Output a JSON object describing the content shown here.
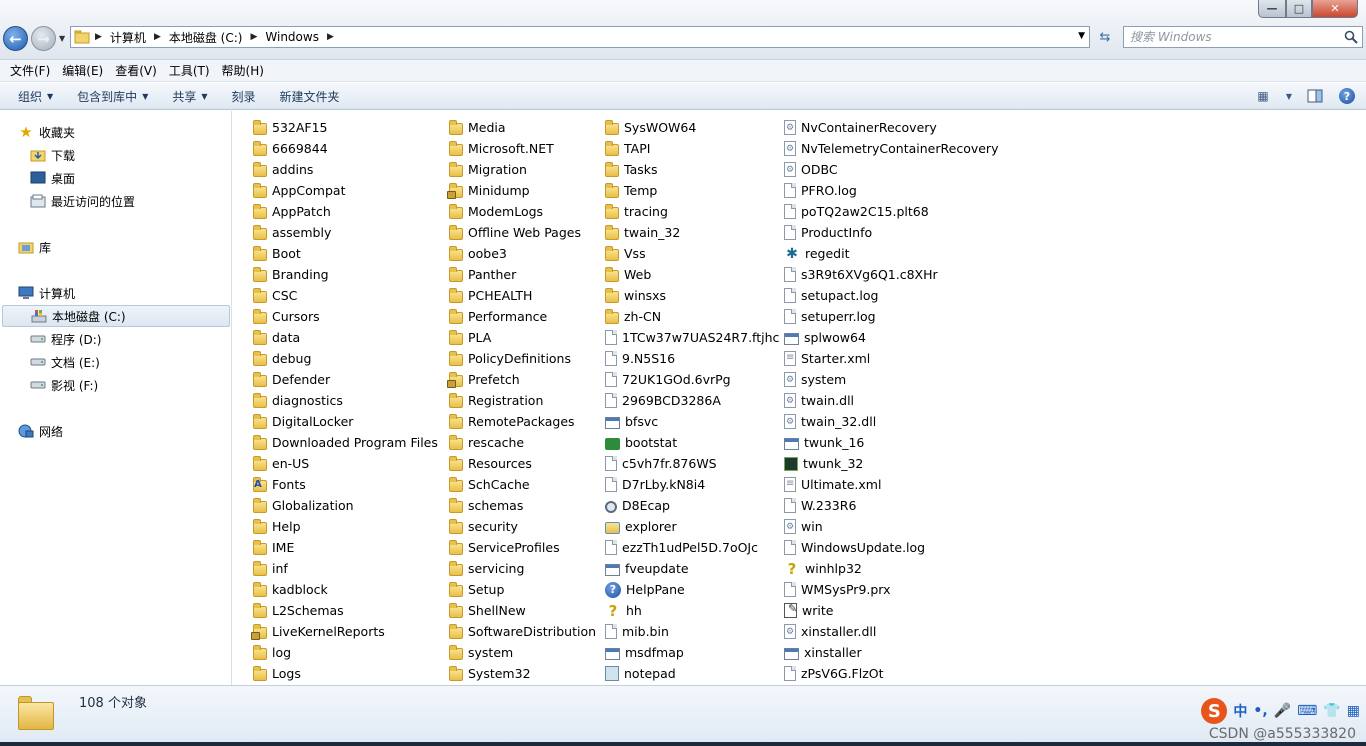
{
  "window": {
    "controls": {
      "minimize": "—",
      "maximize": "□",
      "close": "✕"
    }
  },
  "address": {
    "crumbs": [
      "计算机",
      "本地磁盘 (C:)",
      "Windows"
    ]
  },
  "search": {
    "placeholder": "搜索 Windows"
  },
  "menu": [
    "文件(F)",
    "编辑(E)",
    "查看(V)",
    "工具(T)",
    "帮助(H)"
  ],
  "commands": {
    "organize": "组织",
    "include_in_library": "包含到库中",
    "share": "共享",
    "burn": "刻录",
    "new_folder": "新建文件夹"
  },
  "nav": {
    "favorites": "收藏夹",
    "downloads": "下载",
    "desktop": "桌面",
    "recent": "最近访问的位置",
    "libraries": "库",
    "computer": "计算机",
    "drive_c": "本地磁盘 (C:)",
    "drive_d": "程序 (D:)",
    "drive_e": "文档 (E:)",
    "drive_f": "影视 (F:)",
    "network": "网络"
  },
  "files": {
    "col1": [
      {
        "name": "532AF15",
        "icon": "folder"
      },
      {
        "name": "6669844",
        "icon": "folder"
      },
      {
        "name": "addins",
        "icon": "folder"
      },
      {
        "name": "AppCompat",
        "icon": "folder"
      },
      {
        "name": "AppPatch",
        "icon": "folder"
      },
      {
        "name": "assembly",
        "icon": "folder"
      },
      {
        "name": "Boot",
        "icon": "folder"
      },
      {
        "name": "Branding",
        "icon": "folder"
      },
      {
        "name": "CSC",
        "icon": "folder"
      },
      {
        "name": "Cursors",
        "icon": "folder"
      },
      {
        "name": "data",
        "icon": "folder"
      },
      {
        "name": "debug",
        "icon": "folder"
      },
      {
        "name": "Defender",
        "icon": "folder"
      },
      {
        "name": "diagnostics",
        "icon": "folder"
      },
      {
        "name": "DigitalLocker",
        "icon": "folder"
      },
      {
        "name": "Downloaded Program Files",
        "icon": "folder"
      },
      {
        "name": "en-US",
        "icon": "folder"
      },
      {
        "name": "Fonts",
        "icon": "fontfolder"
      },
      {
        "name": "Globalization",
        "icon": "folder"
      },
      {
        "name": "Help",
        "icon": "folder"
      },
      {
        "name": "IME",
        "icon": "folder"
      },
      {
        "name": "inf",
        "icon": "folder"
      },
      {
        "name": "kadblock",
        "icon": "folder"
      },
      {
        "name": "L2Schemas",
        "icon": "folder"
      },
      {
        "name": "LiveKernelReports",
        "icon": "lockfolder"
      },
      {
        "name": "log",
        "icon": "folder"
      },
      {
        "name": "Logs",
        "icon": "folder"
      }
    ],
    "col2": [
      {
        "name": "Media",
        "icon": "folder"
      },
      {
        "name": "Microsoft.NET",
        "icon": "folder"
      },
      {
        "name": "Migration",
        "icon": "folder"
      },
      {
        "name": "Minidump",
        "icon": "lockfolder"
      },
      {
        "name": "ModemLogs",
        "icon": "folder"
      },
      {
        "name": "Offline Web Pages",
        "icon": "folder"
      },
      {
        "name": "oobe3",
        "icon": "folder"
      },
      {
        "name": "Panther",
        "icon": "folder"
      },
      {
        "name": "PCHEALTH",
        "icon": "folder"
      },
      {
        "name": "Performance",
        "icon": "folder"
      },
      {
        "name": "PLA",
        "icon": "folder"
      },
      {
        "name": "PolicyDefinitions",
        "icon": "folder"
      },
      {
        "name": "Prefetch",
        "icon": "lockfolder"
      },
      {
        "name": "Registration",
        "icon": "folder"
      },
      {
        "name": "RemotePackages",
        "icon": "folder"
      },
      {
        "name": "rescache",
        "icon": "folder"
      },
      {
        "name": "Resources",
        "icon": "folder"
      },
      {
        "name": "SchCache",
        "icon": "folder"
      },
      {
        "name": "schemas",
        "icon": "folder"
      },
      {
        "name": "security",
        "icon": "folder"
      },
      {
        "name": "ServiceProfiles",
        "icon": "folder"
      },
      {
        "name": "servicing",
        "icon": "folder"
      },
      {
        "name": "Setup",
        "icon": "folder"
      },
      {
        "name": "ShellNew",
        "icon": "folder"
      },
      {
        "name": "SoftwareDistribution",
        "icon": "folder"
      },
      {
        "name": "system",
        "icon": "folder"
      },
      {
        "name": "System32",
        "icon": "folder"
      }
    ],
    "col3": [
      {
        "name": "SysWOW64",
        "icon": "folder"
      },
      {
        "name": "TAPI",
        "icon": "folder"
      },
      {
        "name": "Tasks",
        "icon": "folder"
      },
      {
        "name": "Temp",
        "icon": "folder"
      },
      {
        "name": "tracing",
        "icon": "folder"
      },
      {
        "name": "twain_32",
        "icon": "folder"
      },
      {
        "name": "Vss",
        "icon": "folder"
      },
      {
        "name": "Web",
        "icon": "folder"
      },
      {
        "name": "winsxs",
        "icon": "folder"
      },
      {
        "name": "zh-CN",
        "icon": "folder"
      },
      {
        "name": "1TCw37w7UAS24R7.ftjhc",
        "icon": "file"
      },
      {
        "name": "9.N5S16",
        "icon": "file"
      },
      {
        "name": "72UK1GOd.6vrPg",
        "icon": "file"
      },
      {
        "name": "2969BCD3286A",
        "icon": "file"
      },
      {
        "name": "bfsvc",
        "icon": "exe"
      },
      {
        "name": "bootstat",
        "icon": "green"
      },
      {
        "name": "c5vh7fr.876WS",
        "icon": "file"
      },
      {
        "name": "D7rLby.kN8i4",
        "icon": "file"
      },
      {
        "name": "D8Ecap",
        "icon": "cam"
      },
      {
        "name": "explorer",
        "icon": "explorer"
      },
      {
        "name": "ezzTh1udPel5D.7oOJc",
        "icon": "file"
      },
      {
        "name": "fveupdate",
        "icon": "exe"
      },
      {
        "name": "HelpPane",
        "icon": "help"
      },
      {
        "name": "hh",
        "icon": "hlp"
      },
      {
        "name": "mib.bin",
        "icon": "file"
      },
      {
        "name": "msdfmap",
        "icon": "exe"
      },
      {
        "name": "notepad",
        "icon": "notepad"
      }
    ],
    "col4": [
      {
        "name": "NvContainerRecovery",
        "icon": "dll"
      },
      {
        "name": "NvTelemetryContainerRecovery",
        "icon": "dll"
      },
      {
        "name": "ODBC",
        "icon": "dll"
      },
      {
        "name": "PFRO.log",
        "icon": "file"
      },
      {
        "name": "poTQ2aw2C15.plt68",
        "icon": "file"
      },
      {
        "name": "ProductInfo",
        "icon": "file"
      },
      {
        "name": "regedit",
        "icon": "regedit"
      },
      {
        "name": "s3R9t6XVg6Q1.c8XHr",
        "icon": "file"
      },
      {
        "name": "setupact.log",
        "icon": "file"
      },
      {
        "name": "setuperr.log",
        "icon": "file"
      },
      {
        "name": "splwow64",
        "icon": "exe"
      },
      {
        "name": "Starter.xml",
        "icon": "xml"
      },
      {
        "name": "system",
        "icon": "dll"
      },
      {
        "name": "twain.dll",
        "icon": "dll"
      },
      {
        "name": "twain_32.dll",
        "icon": "dll"
      },
      {
        "name": "twunk_16",
        "icon": "exe"
      },
      {
        "name": "twunk_32",
        "icon": "dark"
      },
      {
        "name": "Ultimate.xml",
        "icon": "xml"
      },
      {
        "name": "W.233R6",
        "icon": "file"
      },
      {
        "name": "win",
        "icon": "dll"
      },
      {
        "name": "WindowsUpdate.log",
        "icon": "file"
      },
      {
        "name": "winhlp32",
        "icon": "hlp"
      },
      {
        "name": "WMSysPr9.prx",
        "icon": "file"
      },
      {
        "name": "write",
        "icon": "write"
      },
      {
        "name": "xinstaller.dll",
        "icon": "dll"
      },
      {
        "name": "xinstaller",
        "icon": "exe"
      },
      {
        "name": "zPsV6G.FlzOt",
        "icon": "file"
      }
    ]
  },
  "status": {
    "count": "108 个对象"
  },
  "ime": {
    "logo": "S",
    "lang": "中",
    "punct": "•,",
    "mic": "🎤",
    "keyboard": "⌨",
    "skin": "👕",
    "grid": "▦"
  },
  "watermark": "CSDN @a555333820"
}
